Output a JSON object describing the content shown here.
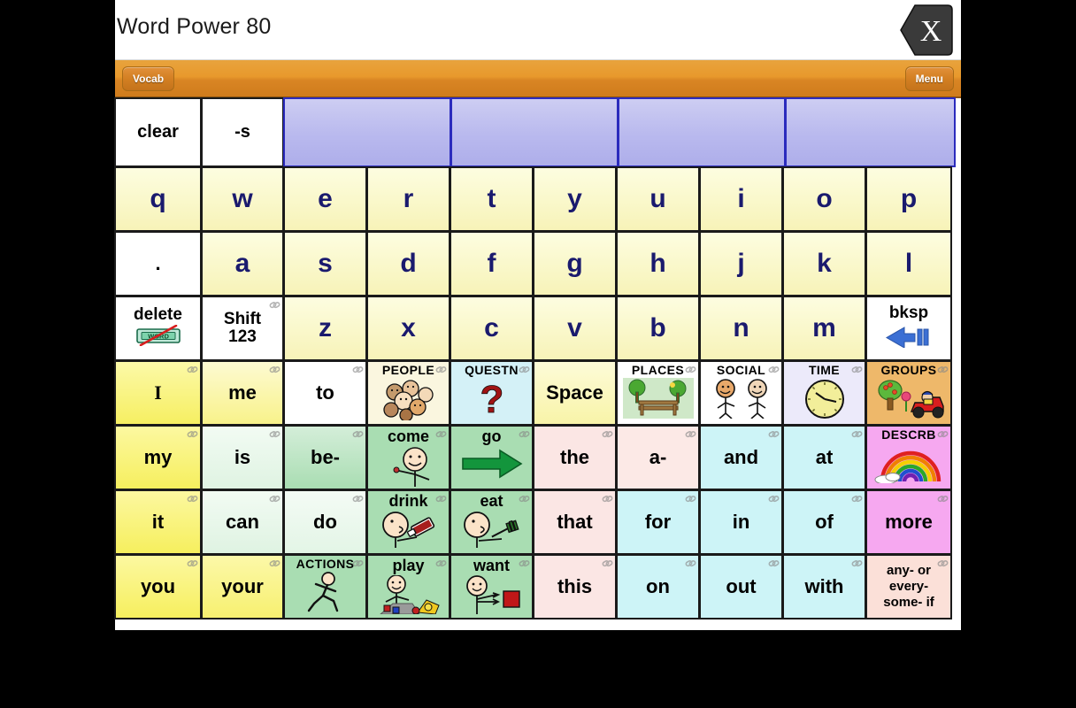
{
  "window": {
    "title": "Word Power 80",
    "close_label": "X",
    "close_icon": "hexagon-x-icon"
  },
  "toolbar": {
    "vocab_label": "Vocab",
    "menu_label": "Menu",
    "background": "#d98524"
  },
  "colors": {
    "key_yellow": "#f9f6c4",
    "letter_blue": "#1a1a6e",
    "message_bar": "#b9b9ee",
    "pronoun_yellow": "#f7f06a",
    "verb_green": "#a9dcb0",
    "verb_green_light": "#ddf2e0",
    "article_pink": "#fbe0e0",
    "preposition_cyan": "#cdf4f7",
    "describe_magenta": "#f6a8f0",
    "group_orange": "#f0c07a"
  },
  "message_bar": {
    "cells": [
      {
        "label": "clear",
        "style": "white"
      },
      {
        "label": "-s",
        "style": "white"
      },
      {
        "label": "",
        "style": "message"
      },
      {
        "label": "",
        "style": "message"
      },
      {
        "label": "",
        "style": "message"
      },
      {
        "label": "",
        "style": "message"
      }
    ]
  },
  "keyboard": {
    "row1": [
      {
        "label": "q"
      },
      {
        "label": "w"
      },
      {
        "label": "e"
      },
      {
        "label": "r"
      },
      {
        "label": "t"
      },
      {
        "label": "y"
      },
      {
        "label": "u"
      },
      {
        "label": "i"
      },
      {
        "label": "o"
      },
      {
        "label": "p"
      }
    ],
    "row2": [
      {
        "label": ".",
        "style": "white"
      },
      {
        "label": "a"
      },
      {
        "label": "s"
      },
      {
        "label": "d"
      },
      {
        "label": "f"
      },
      {
        "label": "g"
      },
      {
        "label": "h"
      },
      {
        "label": "j"
      },
      {
        "label": "k"
      },
      {
        "label": "l"
      }
    ],
    "row3": [
      {
        "label": "delete",
        "style": "white",
        "icon": "delete-word-icon"
      },
      {
        "label": "Shift 123",
        "line1": "Shift",
        "line2": "123",
        "style": "white",
        "link": true
      },
      {
        "label": "z"
      },
      {
        "label": "x"
      },
      {
        "label": "c"
      },
      {
        "label": "v"
      },
      {
        "label": "b"
      },
      {
        "label": "n"
      },
      {
        "label": "m"
      },
      {
        "label": "bksp",
        "style": "white",
        "icon": "backspace-arrow-icon"
      }
    ]
  },
  "core_rows": [
    {
      "cells": [
        {
          "label": "I",
          "color": "pronoun_yellow",
          "link": true
        },
        {
          "label": "me",
          "color": "pronoun_yellow_light",
          "link": true
        },
        {
          "label": "to",
          "color": "white",
          "link": true
        },
        {
          "label": "PEOPLE",
          "color": "cream",
          "icon": "people-faces-icon",
          "caption": true,
          "link": true
        },
        {
          "label": "QUESTN",
          "color": "question_cyan",
          "icon": "question-mark-icon",
          "caption": true,
          "link": true
        },
        {
          "label": "Space",
          "color": "key_yellow",
          "link": false
        },
        {
          "label": "PLACES",
          "color": "white",
          "icon": "park-bench-icon",
          "caption": true,
          "link": true
        },
        {
          "label": "SOCIAL",
          "color": "white",
          "icon": "two-people-icon",
          "caption": true,
          "link": true
        },
        {
          "label": "TIME",
          "color": "lavender",
          "icon": "clock-icon",
          "caption": true,
          "link": true
        },
        {
          "label": "GROUPS",
          "color": "group_orange",
          "icon": "tree-car-icon",
          "caption": true,
          "link": true
        }
      ]
    },
    {
      "cells": [
        {
          "label": "my",
          "color": "pronoun_yellow",
          "link": true
        },
        {
          "label": "is",
          "color": "verb_green_light",
          "link": true
        },
        {
          "label": "be-",
          "color": "verb_green",
          "link": true
        },
        {
          "label": "come",
          "color": "verb_green",
          "icon": "person-waving-icon",
          "link": true
        },
        {
          "label": "go",
          "color": "verb_green",
          "icon": "green-arrow-icon",
          "link": true
        },
        {
          "label": "the",
          "color": "article_pink",
          "link": true
        },
        {
          "label": "a-",
          "color": "article_pink",
          "link": true
        },
        {
          "label": "and",
          "color": "preposition_cyan",
          "link": true
        },
        {
          "label": "at",
          "color": "preposition_cyan",
          "link": true
        },
        {
          "label": "DESCRB",
          "color": "describe_magenta",
          "icon": "rainbow-icon",
          "caption": true,
          "link": true
        }
      ]
    },
    {
      "cells": [
        {
          "label": "it",
          "color": "pronoun_yellow",
          "link": true
        },
        {
          "label": "can",
          "color": "verb_green_light",
          "link": true
        },
        {
          "label": "do",
          "color": "verb_green_light",
          "link": true
        },
        {
          "label": "drink",
          "color": "verb_green",
          "icon": "person-drinking-icon",
          "link": true
        },
        {
          "label": "eat",
          "color": "verb_green",
          "icon": "person-eating-icon",
          "link": true
        },
        {
          "label": "that",
          "color": "article_pink",
          "link": true
        },
        {
          "label": "for",
          "color": "preposition_cyan",
          "link": true
        },
        {
          "label": "in",
          "color": "preposition_cyan",
          "link": true
        },
        {
          "label": "of",
          "color": "preposition_cyan",
          "link": true
        },
        {
          "label": "more",
          "color": "describe_magenta",
          "link": true
        }
      ]
    },
    {
      "cells": [
        {
          "label": "you",
          "color": "pronoun_yellow",
          "link": true
        },
        {
          "label": "your",
          "color": "pronoun_yellow",
          "link": true
        },
        {
          "label": "ACTIONS",
          "color": "verb_green",
          "icon": "running-person-icon",
          "caption": true,
          "link": true
        },
        {
          "label": "play",
          "color": "verb_green",
          "icon": "child-playing-icon",
          "link": true
        },
        {
          "label": "want",
          "color": "verb_green",
          "icon": "person-wanting-icon",
          "link": true
        },
        {
          "label": "this",
          "color": "article_pink",
          "link": true
        },
        {
          "label": "on",
          "color": "preposition_cyan",
          "link": true
        },
        {
          "label": "out",
          "color": "preposition_cyan",
          "link": true
        },
        {
          "label": "with",
          "color": "preposition_cyan",
          "link": true
        },
        {
          "label": "any- or every- some- if",
          "line1": "any- or",
          "line2": "every-",
          "line3": "some- if",
          "color": "article_pink",
          "multiline": true,
          "link": true
        }
      ]
    }
  ]
}
